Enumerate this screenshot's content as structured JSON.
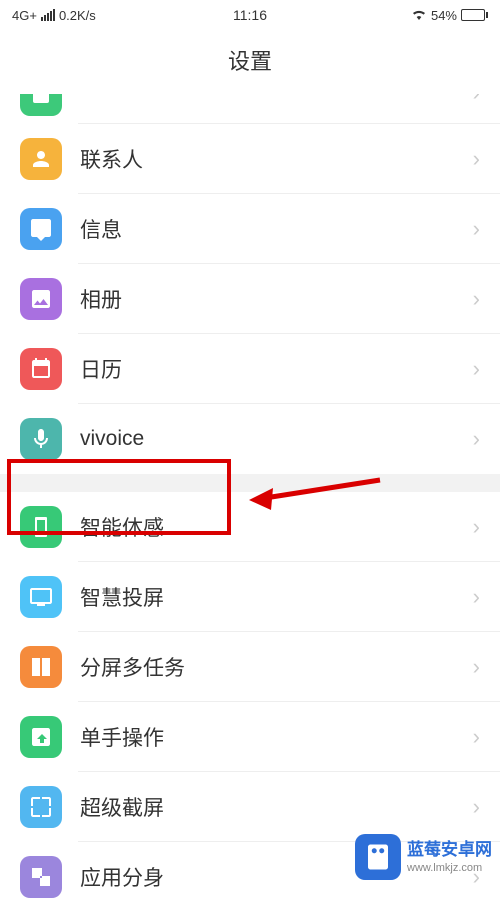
{
  "status": {
    "network": "4G+",
    "speed": "0.2K/s",
    "time": "11:16",
    "battery_pct": "54%",
    "battery_fill": 54
  },
  "header": {
    "title": "设置"
  },
  "group1": {
    "partial_label": "",
    "items": [
      {
        "label": "联系人"
      },
      {
        "label": "信息"
      },
      {
        "label": "相册"
      },
      {
        "label": "日历"
      },
      {
        "label": "vivoice"
      }
    ]
  },
  "group2": {
    "items": [
      {
        "label": "智能体感"
      },
      {
        "label": "智慧投屏"
      },
      {
        "label": "分屏多任务"
      },
      {
        "label": "单手操作"
      },
      {
        "label": "超级截屏"
      },
      {
        "label": "应用分身"
      }
    ]
  },
  "watermark": {
    "title": "蓝莓安卓网",
    "url": "www.lmkjz.com"
  }
}
